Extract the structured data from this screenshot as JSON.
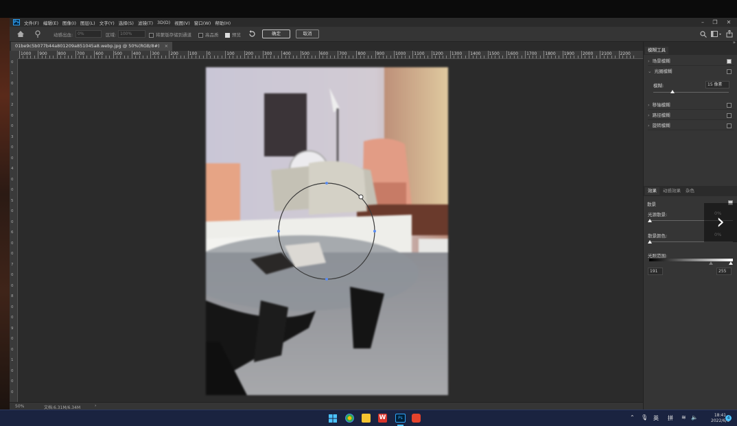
{
  "app": {
    "logo": "Ps",
    "menus": [
      "文件(F)",
      "编辑(E)",
      "图像(I)",
      "图层(L)",
      "文字(Y)",
      "选择(S)",
      "滤镜(T)",
      "3D(D)",
      "视图(V)",
      "窗口(W)",
      "帮助(H)"
    ]
  },
  "options": {
    "auto_strength_label": "动感出血:",
    "auto_strength_value": "0%",
    "fuzziness_label": "区域:",
    "fuzziness_value": "100%",
    "save_mask_label": "将蒙版存储到通道",
    "high_quality_label": "高品质",
    "preview_label": "预览",
    "ok": "确定",
    "cancel": "取消"
  },
  "document": {
    "tab_title": "01be9c5b077b44a801209a851045a8.webp.jpg @ 50%(RGB/8#)",
    "close_icon": "×"
  },
  "rulers": {
    "h_labels": [
      "1000",
      "900",
      "800",
      "700",
      "600",
      "500",
      "400",
      "300",
      "200",
      "100",
      "0",
      "100",
      "200",
      "300",
      "400",
      "500",
      "600",
      "700",
      "800",
      "900",
      "1000",
      "1100",
      "1200",
      "1300",
      "1400",
      "1500",
      "1600",
      "1700",
      "1800",
      "1900",
      "2000",
      "2100",
      "2200"
    ],
    "v_labels": [
      "0",
      "1",
      "0",
      "0",
      "2",
      "0",
      "0",
      "3",
      "0",
      "0",
      "4",
      "0",
      "0",
      "5",
      "0",
      "0",
      "6",
      "0",
      "0",
      "7",
      "0",
      "0",
      "8",
      "0",
      "0",
      "9",
      "0",
      "0",
      "1",
      "0",
      "0",
      "0"
    ]
  },
  "status": {
    "zoom": "50%",
    "doc_info": "文档:6.31M/6.34M",
    "arrow": "›"
  },
  "panel": {
    "title": "模糊工具",
    "blur_tools": [
      {
        "label": "场景模糊",
        "checked": true
      },
      {
        "label": "光圈模糊",
        "checked": false
      }
    ],
    "blur_label": "模糊:",
    "blur_value": "15 像素",
    "other_tools": [
      {
        "label": "移轴模糊",
        "checked": false
      },
      {
        "label": "路径模糊",
        "checked": false
      },
      {
        "label": "旋转模糊",
        "checked": false
      }
    ],
    "effects_tabs": [
      "效果",
      "动感效果",
      "杂色"
    ],
    "bokeh_label": "散景",
    "light_bokeh_label": "光源散景:",
    "light_bokeh_value": "0%",
    "bokeh_color_label": "散景颜色:",
    "bokeh_color_value": "0%",
    "light_range_label": "光照范围:",
    "range_low": "191",
    "range_high": "255"
  },
  "taskbar": {
    "ime_lang": "英",
    "ime_mode": "拼",
    "time": "18:41",
    "date": "2022/6/6",
    "notification_count": "4"
  },
  "colors": {
    "accent": "#31a8ff",
    "panel_bg": "#353535",
    "canvas_bg": "#2b2b2b",
    "taskbar_bg": "#1a2340"
  }
}
